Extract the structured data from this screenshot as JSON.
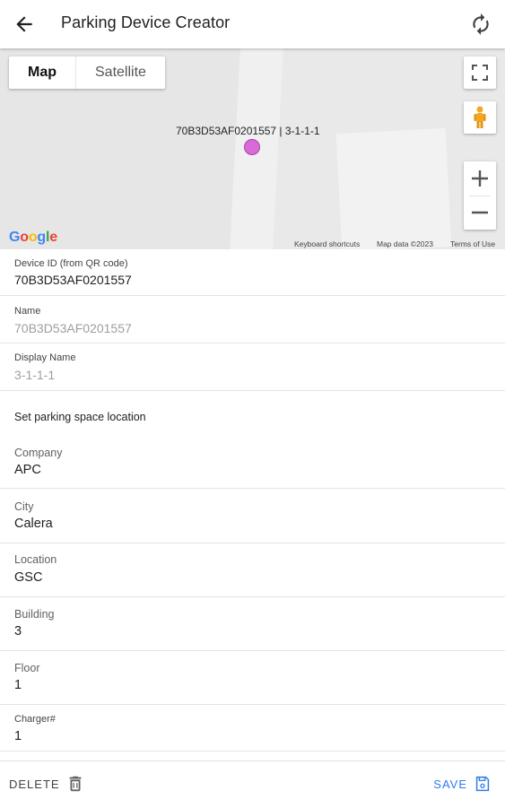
{
  "appbar": {
    "title": "Parking Device Creator",
    "back_icon": "arrow-back-icon",
    "refresh_icon": "refresh-icon"
  },
  "map": {
    "type_map": "Map",
    "type_satellite": "Satellite",
    "marker_label": "70B3D53AF0201557 | 3-1-1-1",
    "marker_color": "#d96ad7",
    "google_letters": [
      "G",
      "o",
      "o",
      "g",
      "l",
      "e"
    ],
    "google_colors": [
      "#4285F4",
      "#EA4335",
      "#FBBC05",
      "#4285F4",
      "#34A853",
      "#EA4335"
    ],
    "keyboard_shortcuts": "Keyboard shortcuts",
    "map_data": "Map data ©2023",
    "terms": "Terms of Use",
    "zoom_in": "+",
    "zoom_out": "−"
  },
  "device": {
    "device_id_label": "Device ID (from QR code)",
    "device_id_value": "70B3D53AF0201557",
    "name_label": "Name",
    "name_value": "70B3D53AF0201557",
    "display_name_label": "Display Name",
    "display_name_value": "3-1-1-1"
  },
  "location": {
    "section_title": "Set parking space location",
    "company_label": "Company",
    "company_value": "APC",
    "city_label": "City",
    "city_value": "Calera",
    "location_label": "Location",
    "location_value": "GSC",
    "building_label": "Building",
    "building_value": "3",
    "floor_label": "Floor",
    "floor_value": "1",
    "charger_label": "Charger#",
    "charger_value": "1"
  },
  "bottombar": {
    "delete_label": "DELETE",
    "save_label": "SAVE",
    "accent": "#2f7be6"
  }
}
